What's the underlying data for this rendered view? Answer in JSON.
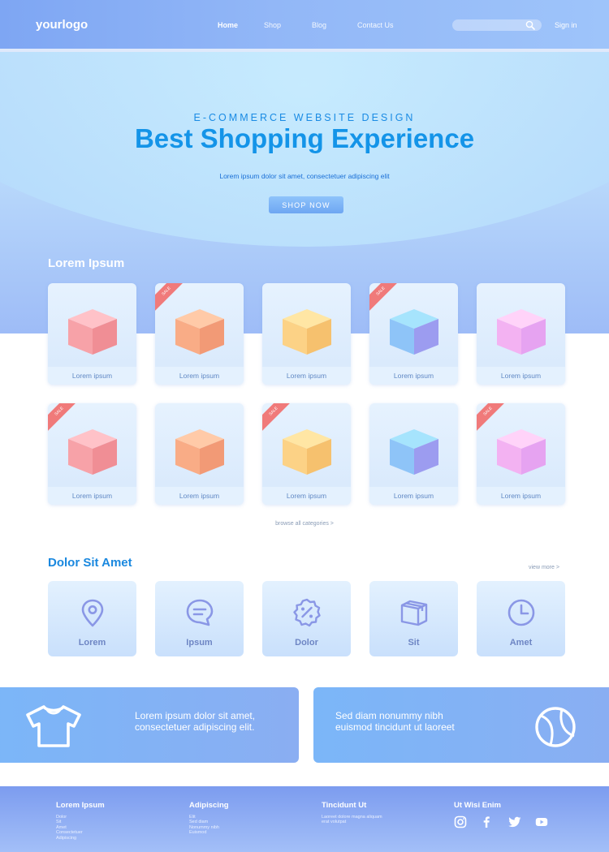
{
  "nav": {
    "logo": "yourlogo",
    "links": [
      "Home",
      "Shop",
      "Blog",
      "Contact Us"
    ],
    "search_placeholder": "",
    "signin": "Sign in"
  },
  "hero": {
    "kicker": "E-COMMERCE WEBSITE DESIGN",
    "title": "Best Shopping Experience",
    "subtitle": "Lorem ipsum dolor sit amet, consectetuer adipiscing elit",
    "button": "SHOP NOW"
  },
  "products": {
    "title": "Lorem Ipsum",
    "sale_badge": "SALE",
    "items": [
      {
        "label": "Lorem ipsum",
        "sale": false,
        "color": "red"
      },
      {
        "label": "Lorem ipsum",
        "sale": true,
        "color": "orange"
      },
      {
        "label": "Lorem ipsum",
        "sale": false,
        "color": "yellow"
      },
      {
        "label": "Lorem ipsum",
        "sale": true,
        "color": "blue"
      },
      {
        "label": "Lorem ipsum",
        "sale": false,
        "color": "pink"
      },
      {
        "label": "Lorem ipsum",
        "sale": true,
        "color": "red"
      },
      {
        "label": "Lorem ipsum",
        "sale": false,
        "color": "orange"
      },
      {
        "label": "Lorem ipsum",
        "sale": true,
        "color": "yellow"
      },
      {
        "label": "Lorem ipsum",
        "sale": false,
        "color": "blue"
      },
      {
        "label": "Lorem ipsum",
        "sale": true,
        "color": "pink"
      }
    ],
    "browse_link": "browse all categories >"
  },
  "categories": {
    "title": "Dolor Sit Amet",
    "view_more": "view more >",
    "items": [
      {
        "label": "Lorem",
        "icon": "location-pin-icon"
      },
      {
        "label": "Ipsum",
        "icon": "chat-bubble-icon"
      },
      {
        "label": "Dolor",
        "icon": "discount-badge-icon"
      },
      {
        "label": "Sit",
        "icon": "package-box-icon"
      },
      {
        "label": "Amet",
        "icon": "clock-icon"
      }
    ]
  },
  "promos": [
    {
      "text": [
        "Lorem ipsum dolor sit amet,",
        "consectetuer adipiscing elit."
      ],
      "icon": "t-shirt-icon"
    },
    {
      "text": [
        "Sed diam nonummy nibh",
        "euismod tincidunt ut laoreet"
      ],
      "icon": "ball-icon"
    }
  ],
  "footer": {
    "columns": [
      {
        "title": "Lorem Ipsum",
        "items": [
          "Dolor",
          "Sit",
          "Amet",
          "Consectetuer",
          "Adipiscing"
        ]
      },
      {
        "title": "Adipiscing",
        "items": [
          "Elit",
          "Sed diam",
          "Nonummy nibh",
          "Euismod"
        ]
      },
      {
        "title": "Tincidunt Ut",
        "items": [
          "Laoreet dolore magna aliquam",
          "erat volutpat"
        ]
      },
      {
        "title": "Ut Wisi Enim",
        "items": []
      }
    ],
    "social": [
      "instagram-icon",
      "facebook-icon",
      "twitter-icon",
      "youtube-icon"
    ]
  },
  "colors": {
    "accent": "#1494e8",
    "nav_bg": "#8fb3f6",
    "sale_badge": "#f07a7a",
    "category_label": "#6e86c4"
  }
}
